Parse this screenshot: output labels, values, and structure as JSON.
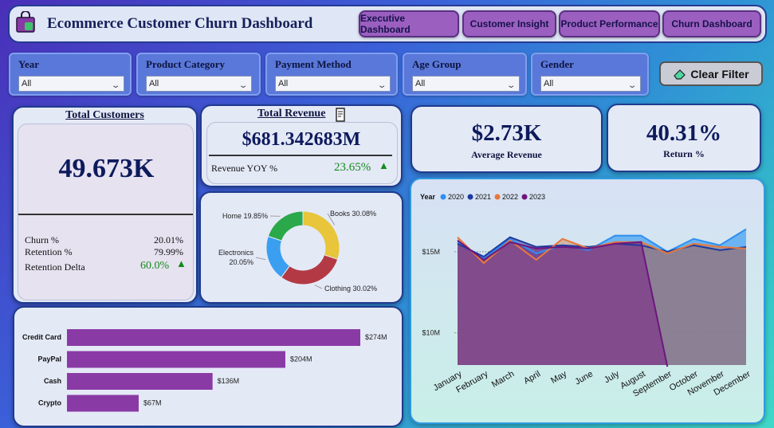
{
  "header": {
    "title": "Ecommerce Customer Churn Dashboard"
  },
  "nav": [
    {
      "label": "Executive Dashboard"
    },
    {
      "label": "Customer Insight"
    },
    {
      "label": "Product Performance"
    },
    {
      "label": "Churn Dashboard"
    }
  ],
  "filters": [
    {
      "label": "Year",
      "value": "All"
    },
    {
      "label": "Product Category",
      "value": "All"
    },
    {
      "label": "Payment Method",
      "value": "All"
    },
    {
      "label": "Age Group",
      "value": "All"
    },
    {
      "label": "Gender",
      "value": "All"
    }
  ],
  "clear_filter": "Clear Filter",
  "customers": {
    "title": "Total Customers",
    "value": "49.673K",
    "churn_label": "Churn %",
    "churn_value": "20.01%",
    "retention_label": "Retention %",
    "retention_value": "79.99%",
    "delta_label": "Retention Delta",
    "delta_value": "60.0%"
  },
  "revenue": {
    "title": "Total Revenue",
    "value": "$681.342683M",
    "yoy_label": "Revenue YOY %",
    "yoy_value": "23.65%"
  },
  "avg_revenue": {
    "value": "$2.73K",
    "label": "Average Revenue"
  },
  "return_pct": {
    "value": "40.31%",
    "label": "Return %"
  },
  "colors": {
    "accent": "#8a3aa5",
    "line2020": "#2f8ff0",
    "line2021": "#1f3a9e",
    "line2022": "#e8783a",
    "line2023": "#6d167f",
    "up": "#138a1c"
  },
  "chart_data": [
    {
      "type": "pie",
      "title": "",
      "labels": [
        "Books",
        "Clothing",
        "Electronics",
        "Home"
      ],
      "values": [
        30.08,
        30.02,
        20.05,
        19.85
      ],
      "display": [
        "Books 30.08%",
        "Clothing 30.02%",
        "Electronics 20.05%",
        "Home 19.85%"
      ],
      "colors": [
        "#e8c53a",
        "#b33a44",
        "#3a9ff0",
        "#2aa84a"
      ]
    },
    {
      "type": "bar",
      "orientation": "horizontal",
      "categories": [
        "Credit Card",
        "PayPal",
        "Cash",
        "Crypto"
      ],
      "values": [
        274,
        204,
        136,
        67
      ],
      "value_labels": [
        "$274M",
        "$204M",
        "$136M",
        "$67M"
      ],
      "unit": "M"
    },
    {
      "type": "area",
      "legend_title": "Year",
      "legend_position": "top-left",
      "categories": [
        "January",
        "February",
        "March",
        "April",
        "May",
        "June",
        "July",
        "August",
        "September",
        "October",
        "November",
        "December"
      ],
      "y_ticks": [
        "$15M",
        "$10M"
      ],
      "y_tick_values": [
        15,
        10
      ],
      "ylim": [
        8.0,
        18.0
      ],
      "series": [
        {
          "name": "2020",
          "values": [
            15.6,
            14.6,
            15.8,
            14.9,
            15.4,
            15.1,
            16.0,
            16.0,
            15.0,
            15.8,
            15.4,
            16.4
          ]
        },
        {
          "name": "2021",
          "values": [
            15.5,
            14.7,
            15.9,
            15.3,
            15.4,
            15.3,
            15.5,
            15.4,
            15.0,
            15.4,
            15.1,
            15.3
          ]
        },
        {
          "name": "2022",
          "values": [
            15.9,
            14.3,
            15.7,
            14.5,
            15.8,
            15.2,
            15.6,
            15.6,
            14.9,
            15.5,
            15.3,
            15.2
          ]
        },
        {
          "name": "2023",
          "values": [
            15.7,
            14.5,
            15.6,
            15.2,
            15.3,
            15.2,
            15.5,
            15.6,
            7.9
          ]
        }
      ]
    }
  ]
}
